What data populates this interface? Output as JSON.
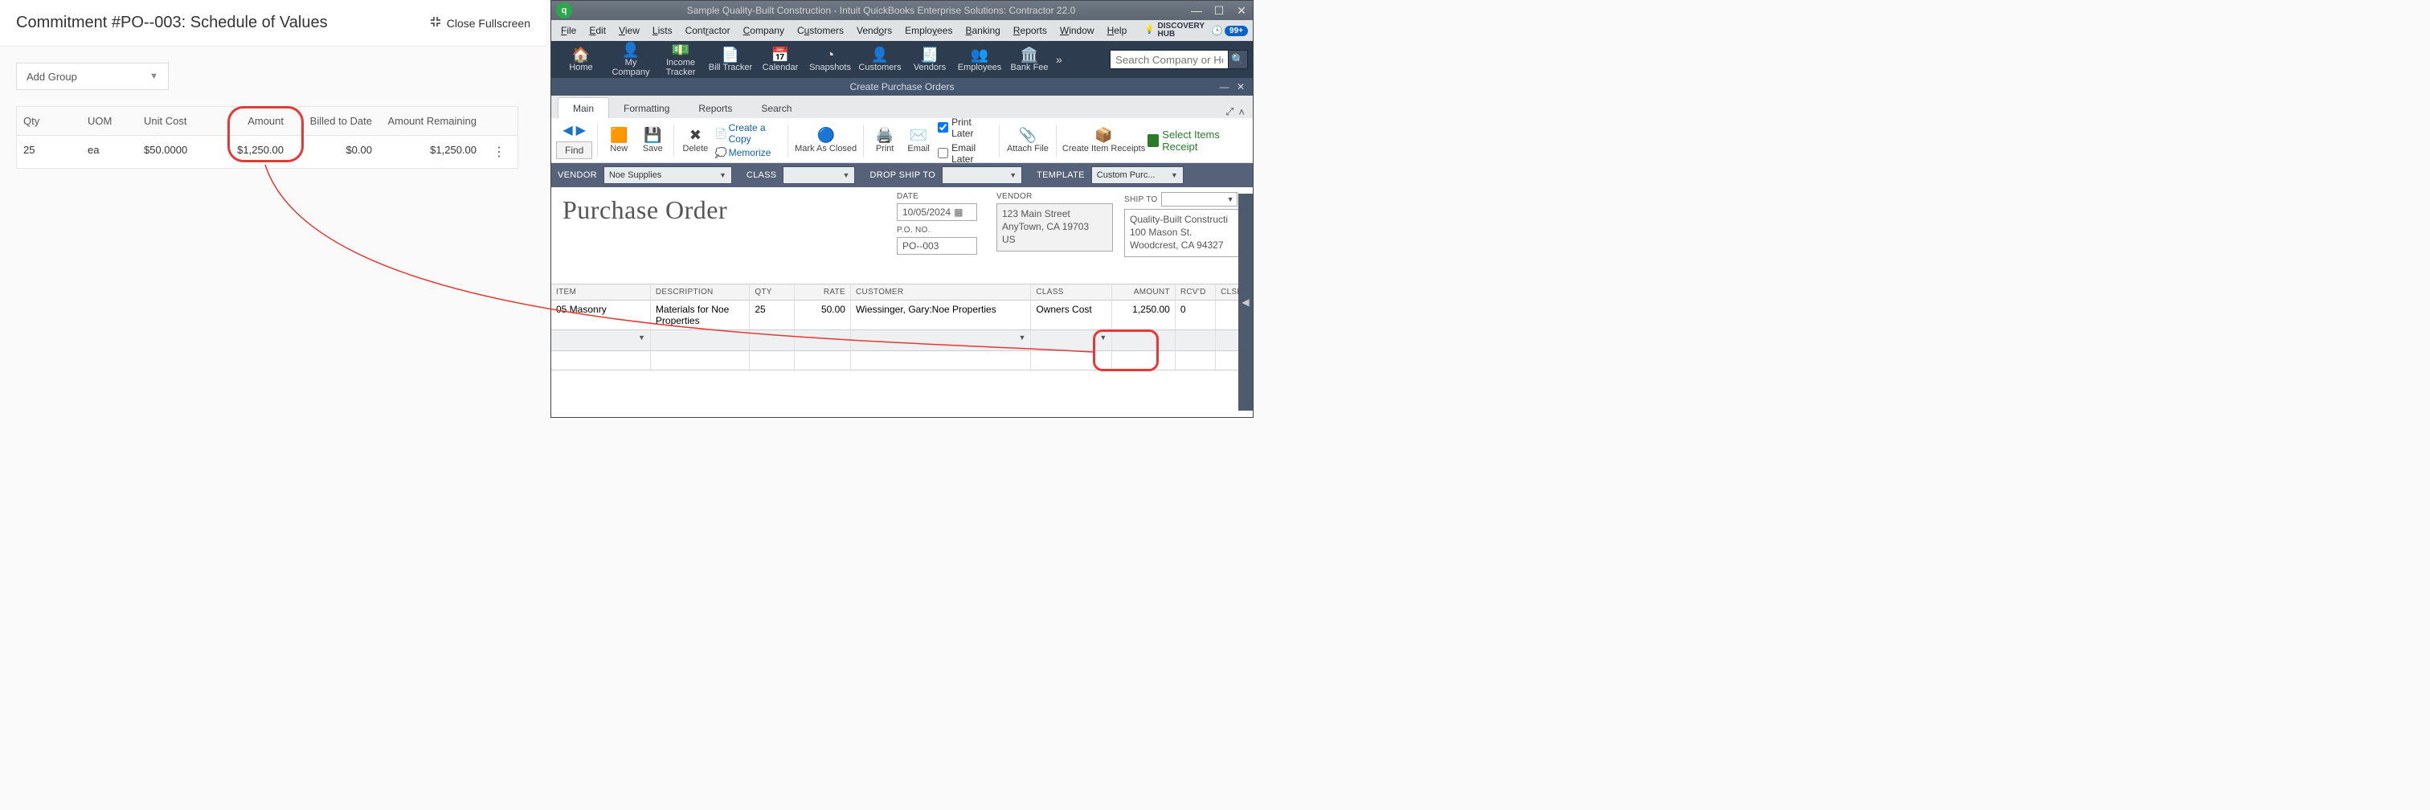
{
  "left": {
    "title": "Commitment #PO--003: Schedule of Values",
    "close_fs_label": "Close Fullscreen",
    "add_group_label": "Add Group",
    "columns": {
      "qty": "Qty",
      "uom": "UOM",
      "unit_cost": "Unit Cost",
      "amount": "Amount",
      "billed": "Billed to Date",
      "remaining": "Amount Remaining"
    },
    "row": {
      "qty": "25",
      "uom": "ea",
      "unit_cost": "$50.0000",
      "amount": "$1,250.00",
      "billed": "$0.00",
      "remaining": "$1,250.00"
    }
  },
  "qb": {
    "title": "Sample Quality-Built Construction  - Intuit QuickBooks Enterprise Solutions: Contractor 22.0",
    "menus": [
      "File",
      "Edit",
      "View",
      "Lists",
      "Contractor",
      "Company",
      "Customers",
      "Vendors",
      "Employees",
      "Banking",
      "Reports",
      "Window",
      "Help"
    ],
    "discovery_label": "DISCOVERY\nHUB",
    "reminder_count": "99+",
    "nav": [
      "Home",
      "My Company",
      "Income Tracker",
      "Bill Tracker",
      "Calendar",
      "Snapshots",
      "Customers",
      "Vendors",
      "Employees",
      "Bank Fee"
    ],
    "search_placeholder": "Search Company or Help",
    "subwindow_title": "Create Purchase Orders",
    "tabs": [
      "Main",
      "Formatting",
      "Reports",
      "Search"
    ],
    "ribbon": {
      "find": "Find",
      "new": "New",
      "save": "Save",
      "delete": "Delete",
      "create_copy": "Create a Copy",
      "memorize": "Memorize",
      "mark_closed": "Mark As Closed",
      "print": "Print",
      "email": "Email",
      "print_later": "Print Later",
      "email_later": "Email Later",
      "attach": "Attach File",
      "create_item": "Create Item Receipts",
      "select_items_receipt": "Select Items Receipt"
    },
    "formbar": {
      "vendor_label": "VENDOR",
      "vendor_value": "Noe Supplies",
      "class_label": "CLASS",
      "dropship_label": "DROP SHIP TO",
      "template_label": "TEMPLATE",
      "template_value": "Custom Purc..."
    },
    "form": {
      "heading": "Purchase Order",
      "date_label": "DATE",
      "date_value": "10/05/2024",
      "pono_label": "P.O. NO.",
      "pono_value": "PO--003",
      "vendor_label": "VENDOR",
      "vendor_addr": "123 Main Street\nAnyTown, CA 19703\nUS",
      "shipto_label": "SHIP TO",
      "shipto_addr": "Quality-Built Constructi\n100 Mason St.\nWoodcrest, CA 94327"
    },
    "po_columns": [
      "ITEM",
      "DESCRIPTION",
      "QTY",
      "RATE",
      "CUSTOMER",
      "CLASS",
      "AMOUNT",
      "RCV'D",
      "CLSD"
    ],
    "po_row": {
      "item": "05 Masonry",
      "desc": "Materials for Noe Properties",
      "qty": "25",
      "rate": "50.00",
      "customer": "Wiessinger, Gary:Noe Properties",
      "class": "Owners Cost",
      "amount": "1,250.00",
      "rcvd": "0",
      "clsd": ""
    }
  }
}
